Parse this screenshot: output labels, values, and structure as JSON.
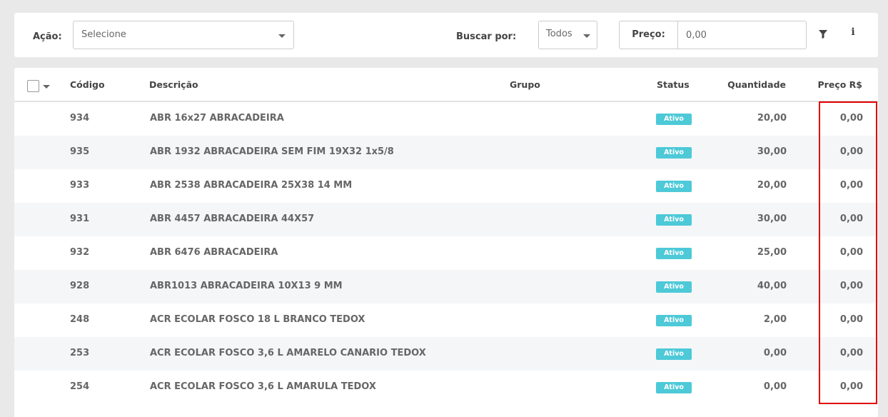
{
  "toolbar": {
    "acao_label": "Ação:",
    "acao_select_value": "Selecione",
    "buscar_label": "Buscar por:",
    "buscar_value": "Todos",
    "preco_label": "Preço:",
    "preco_value": "0,00",
    "filter_icon": "filter-icon",
    "info_icon": "info-icon",
    "info_glyph": "i"
  },
  "table": {
    "headers": {
      "codigo": "Código",
      "descricao": "Descrição",
      "grupo": "Grupo",
      "status": "Status",
      "quantidade": "Quantidade",
      "preco": "Preço R$"
    },
    "rows": [
      {
        "codigo": "934",
        "descricao": "ABR 16x27 ABRACADEIRA",
        "status": "Ativo",
        "quantidade": "20,00",
        "preco": "0,00"
      },
      {
        "codigo": "935",
        "descricao": "ABR 1932 ABRACADEIRA SEM FIM 19X32 1x5/8",
        "status": "Ativo",
        "quantidade": "30,00",
        "preco": "0,00"
      },
      {
        "codigo": "933",
        "descricao": "ABR 2538 ABRACADEIRA 25X38 14 MM",
        "status": "Ativo",
        "quantidade": "20,00",
        "preco": "0,00"
      },
      {
        "codigo": "931",
        "descricao": "ABR 4457 ABRACADEIRA 44X57",
        "status": "Ativo",
        "quantidade": "30,00",
        "preco": "0,00"
      },
      {
        "codigo": "932",
        "descricao": "ABR 6476 ABRACADEIRA",
        "status": "Ativo",
        "quantidade": "25,00",
        "preco": "0,00"
      },
      {
        "codigo": "928",
        "descricao": "ABR1013 ABRACADEIRA 10X13 9 MM",
        "status": "Ativo",
        "quantidade": "40,00",
        "preco": "0,00"
      },
      {
        "codigo": "248",
        "descricao": "ACR ECOLAR FOSCO 18 L BRANCO TEDOX",
        "status": "Ativo",
        "quantidade": "2,00",
        "preco": "0,00"
      },
      {
        "codigo": "253",
        "descricao": "ACR ECOLAR FOSCO 3,6 L AMARELO CANARIO TEDOX",
        "status": "Ativo",
        "quantidade": "0,00",
        "preco": "0,00"
      },
      {
        "codigo": "254",
        "descricao": "ACR ECOLAR FOSCO 3,6 L AMARULA TEDOX",
        "status": "Ativo",
        "quantidade": "0,00",
        "preco": "0,00"
      }
    ]
  },
  "colors": {
    "status_badge": "#4dc9d8",
    "highlight_border": "#e00000",
    "row_alt": "#f5f6f8"
  }
}
